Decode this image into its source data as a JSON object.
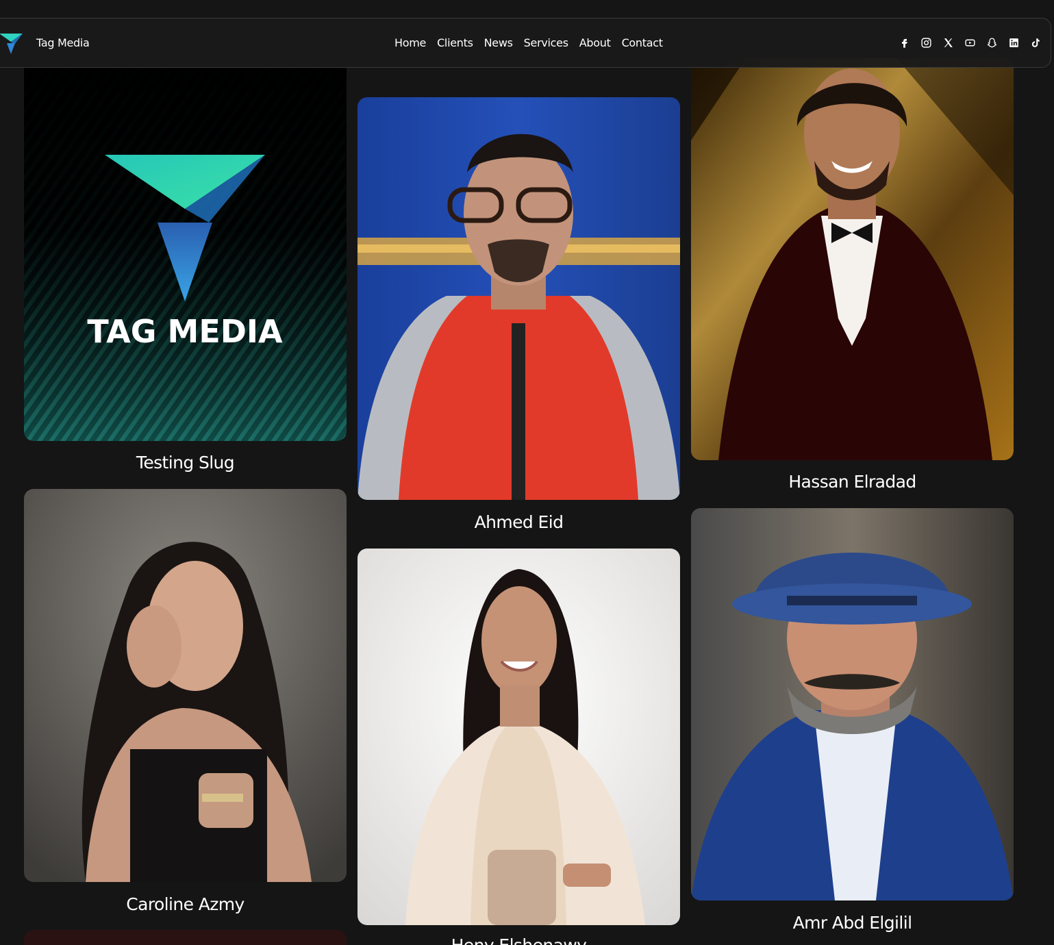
{
  "brand": {
    "name": "Tag Media"
  },
  "nav": {
    "links": [
      "Home",
      "Clients",
      "News",
      "Services",
      "About",
      "Contact"
    ]
  },
  "socials": [
    "facebook-icon",
    "instagram-icon",
    "x-icon",
    "youtube-icon",
    "snapchat-icon",
    "linkedin-icon",
    "tiktok-icon"
  ],
  "logo_card": {
    "text": "TAG MEDIA"
  },
  "clients": [
    {
      "name": "Testing Slug"
    },
    {
      "name": "Ahmed Eid"
    },
    {
      "name": "Hassan Elradad"
    },
    {
      "name": "Caroline Azmy"
    },
    {
      "name": "Heny Elshenawy"
    },
    {
      "name": "Amr Abd Elgilil"
    }
  ],
  "colors": {
    "background": "#151515",
    "accent_teal": "#3fd6c8",
    "accent_blue": "#2a7fd6"
  }
}
